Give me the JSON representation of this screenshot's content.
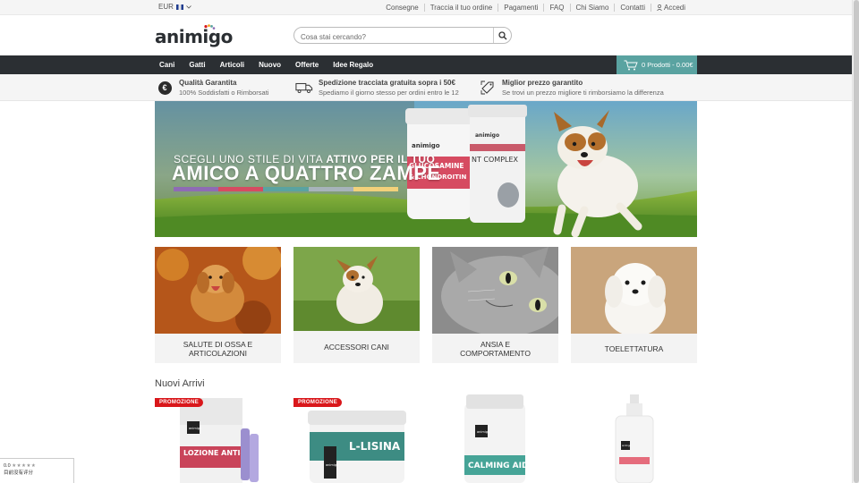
{
  "topbar": {
    "currency": "EUR",
    "links": [
      "Consegne",
      "Traccia il tuo ordine",
      "Pagamenti",
      "FAQ",
      "Chi Siamo",
      "Contatti"
    ],
    "login": "Accedi"
  },
  "header": {
    "logo": "animigo",
    "search_placeholder": "Cosa stai cercando?"
  },
  "nav": {
    "items": [
      "Cani",
      "Gatti",
      "Articoli",
      "Nuovo",
      "Offerte",
      "Idee Regalo"
    ],
    "cart": "0 Prodotti - 0.00€"
  },
  "benefits": [
    {
      "title": "Qualità Garantita",
      "sub": "100% Soddisfatti o Rimborsati",
      "icon": "euro-icon"
    },
    {
      "title": "Spedizione tracciata gratuita sopra i 50€",
      "sub": "Spediamo il giorno stesso per ordini entro le 12",
      "icon": "truck-icon"
    },
    {
      "title": "Miglior prezzo garantito",
      "sub": "Se trovi un prezzo migliore ti rimborsiamo la differenza",
      "icon": "price-tag-icon"
    }
  ],
  "banner": {
    "line1_prefix": "SCEGLI UNO STILE DI VITA ",
    "line1_bold": "ATTIVO PER IL TUO",
    "line2": "AMICO A QUATTRO ZAMPE",
    "product1_brand": "animigo",
    "product1_name_line1": "GLUCOSAMINE",
    "product1_name_line2": "& CHONDROITIN",
    "product2_brand": "animigo",
    "product2_name": "NT COMPLEX"
  },
  "categories": [
    {
      "label": "Salute di ossa e articolazioni"
    },
    {
      "label": "Accessori cani"
    },
    {
      "label": "Ansia e comportamento"
    },
    {
      "label": "Toelettatura"
    }
  ],
  "new_arrivals": {
    "title": "Nuovi Arrivi",
    "promo_label": "PROMOZIONE",
    "products": [
      {
        "brand": "animigo",
        "name": "LOZIONE ANTI-PARASSITARIA",
        "promo": true
      },
      {
        "brand": "animigo",
        "name": "L-LISINA",
        "promo": true
      },
      {
        "brand": "animigo",
        "name": "CALMING AID",
        "promo": false
      },
      {
        "brand": "animigo",
        "name": "",
        "promo": false
      }
    ]
  },
  "rating_widget": {
    "score": "0.0",
    "stars": "★★★★★",
    "text": "目前没有评分"
  },
  "colors": {
    "nav_bg": "#2b2f33",
    "cart_bg": "#5aa3a1",
    "promo_red": "#d9171b"
  }
}
